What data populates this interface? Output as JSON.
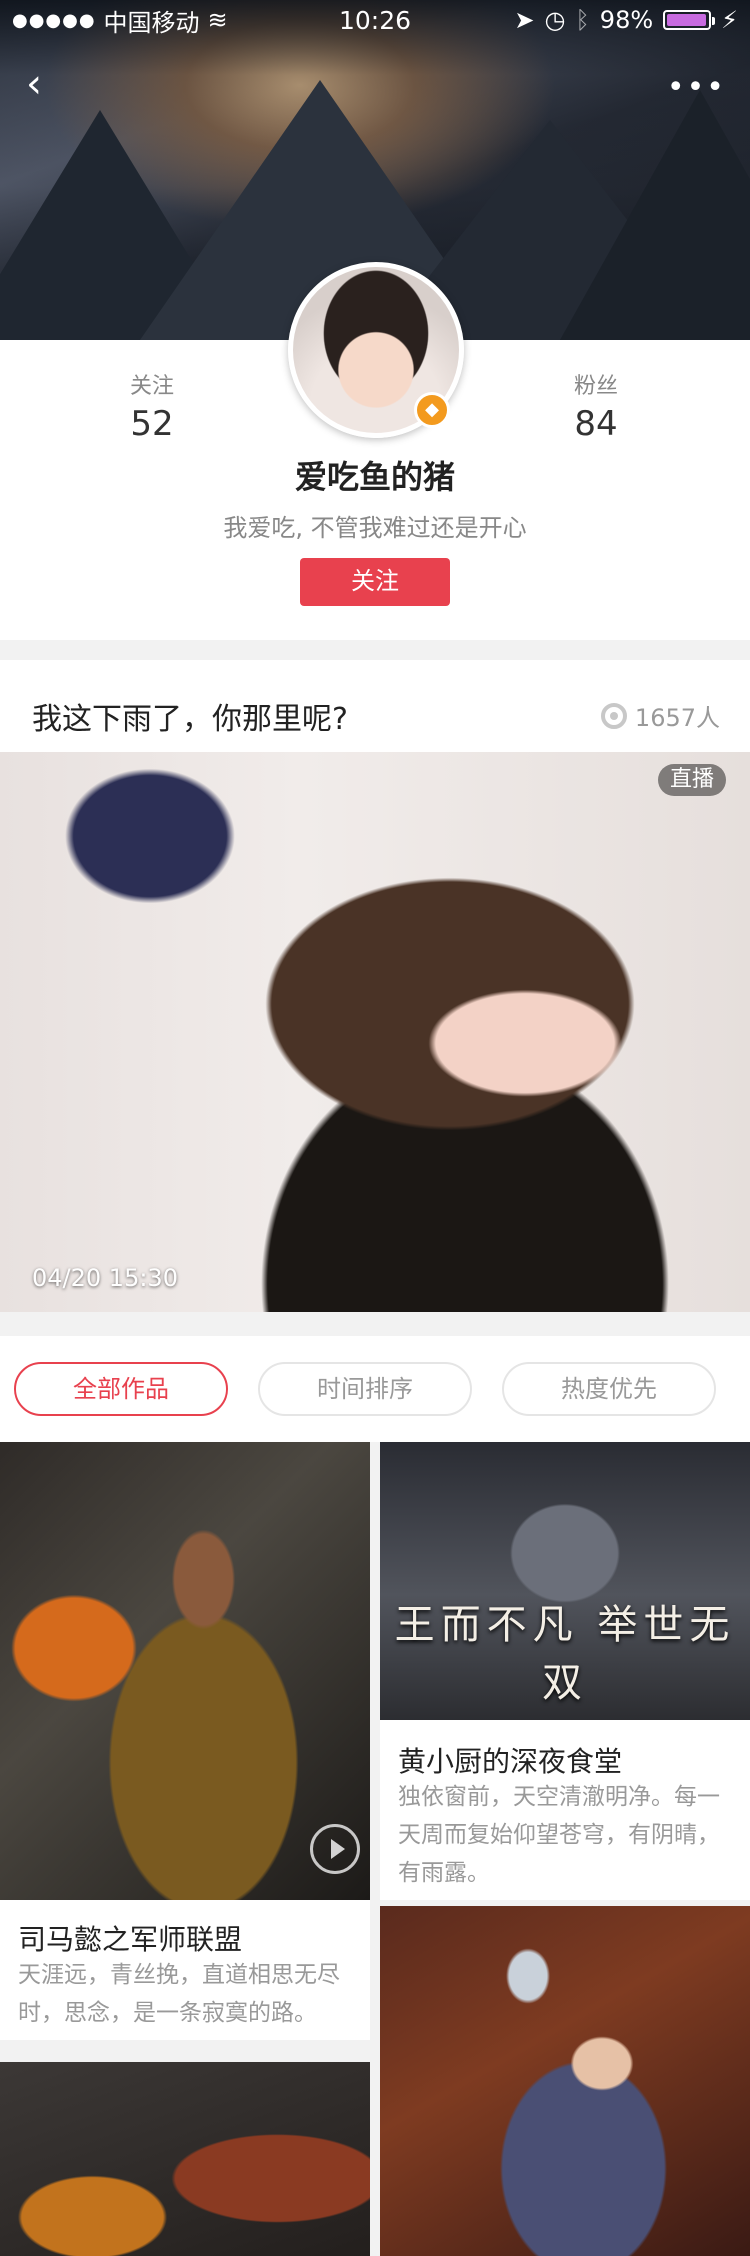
{
  "status_bar": {
    "carrier": "中国移动",
    "time": "10:26",
    "battery": "98%",
    "battery_level": 0.98
  },
  "profile": {
    "following_label": "关注",
    "following_count": "52",
    "fans_label": "粉丝",
    "fans_count": "84",
    "username": "爱吃鱼的猪",
    "bio": "我爱吃, 不管我难过还是开心",
    "follow_button": "关注"
  },
  "live": {
    "title": "我这下雨了，你那里呢?",
    "viewers": "1657人",
    "badge": "直播",
    "time": "04/20 15:30"
  },
  "filters": [
    {
      "label": "全部作品",
      "active": true
    },
    {
      "label": "时间排序",
      "active": false
    },
    {
      "label": "热度优先",
      "active": false
    }
  ],
  "works": [
    {
      "title": "司马懿之军师联盟",
      "desc": "天涯远，青丝挽，直道相思无尽时，思念，是一条寂寞的路。"
    },
    {
      "title": "黄小厨的深夜食堂",
      "desc": "独依窗前，天空清澈明净。每一天周而复始仰望苍穹，有阴晴，有雨露。",
      "art_text": "王而不凡 举世无双"
    }
  ],
  "colors": {
    "accent": "#e8414e",
    "badge": "#f39a1e"
  }
}
